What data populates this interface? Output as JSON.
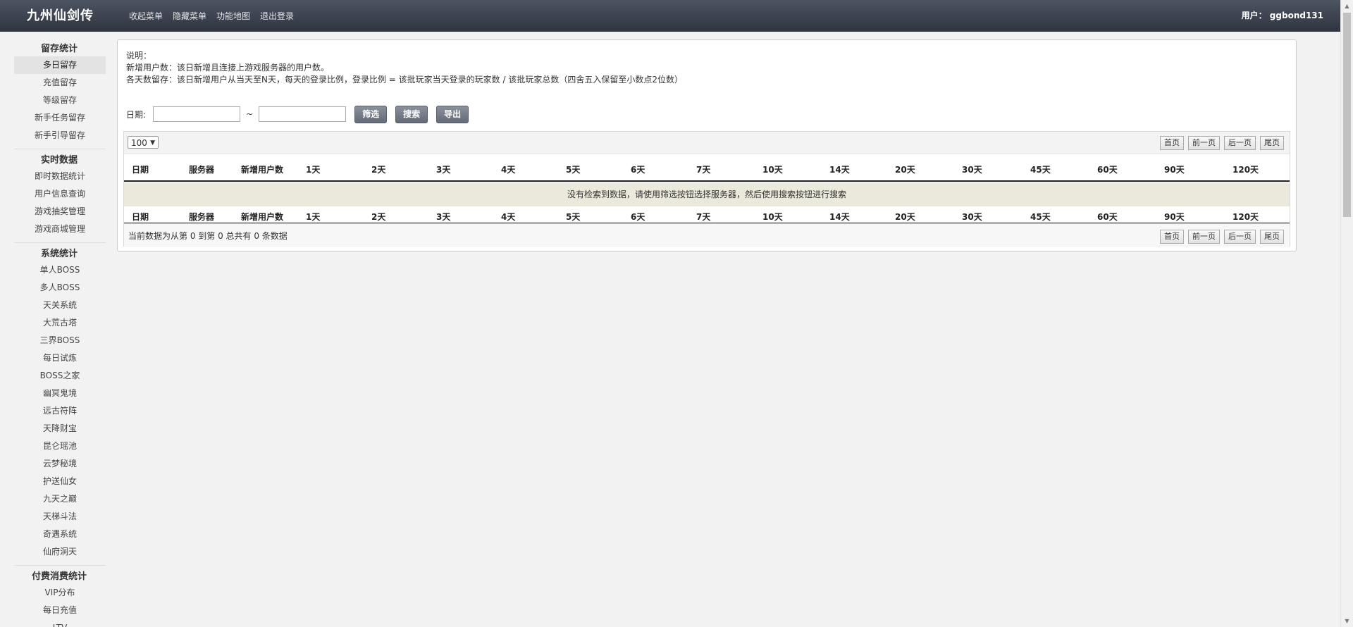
{
  "header": {
    "brand": "九州仙剑传",
    "menu": [
      "收起菜单",
      "隐藏菜单",
      "功能地图",
      "退出登录"
    ],
    "user": "用户： ggbond131"
  },
  "sidebar": {
    "groups": [
      {
        "title": "留存统计",
        "items": [
          "多日留存",
          "充值留存",
          "等级留存",
          "新手任务留存",
          "新手引导留存"
        ]
      },
      {
        "title": "实时数据",
        "items": [
          "即时数据统计",
          "用户信息查询",
          "游戏抽奖管理",
          "游戏商城管理"
        ]
      },
      {
        "title": "系统统计",
        "items": [
          "单人BOSS",
          "多人BOSS",
          "天关系统",
          "大荒古塔",
          "三界BOSS",
          "每日试炼",
          "BOSS之家",
          "幽冥鬼境",
          "远古符阵",
          "天降财宝",
          "昆仑瑶池",
          "云梦秘境",
          "护送仙女",
          "九天之巅",
          "天梯斗法",
          "奇遇系统",
          "仙府洞天"
        ]
      },
      {
        "title": "付费消费统计",
        "items": [
          "VIP分布",
          "每日充值",
          "LTV"
        ]
      }
    ],
    "active": "多日留存"
  },
  "description": {
    "line1": "说明：",
    "line2": "新增用户数：该日新增且连接上游戏服务器的用户数。",
    "line3": "各天数留存：该日新增用户从当天至N天，每天的登录比例，登录比例 = 该批玩家当天登录的玩家数 / 该批玩家总数（四舍五入保留至小数点2位数）"
  },
  "filter": {
    "date_label": "日期:",
    "start_value": "",
    "end_value": "",
    "separator": "~",
    "filter_button": "筛选",
    "search_button": "搜索",
    "export_button": "导出"
  },
  "table": {
    "page_size": "100",
    "pager": [
      "首页",
      "前一页",
      "后一页",
      "尾页"
    ],
    "columns": [
      "日期",
      "服务器",
      "新增用户数",
      "1天",
      "2天",
      "3天",
      "4天",
      "5天",
      "6天",
      "7天",
      "10天",
      "14天",
      "20天",
      "30天",
      "45天",
      "60天",
      "90天",
      "120天"
    ],
    "empty_message": "没有检索到数据，请使用筛选按钮选择服务器，然后使用搜索按钮进行搜索",
    "info": "当前数据为从第 0 到第 0 总共有 0 条数据"
  }
}
